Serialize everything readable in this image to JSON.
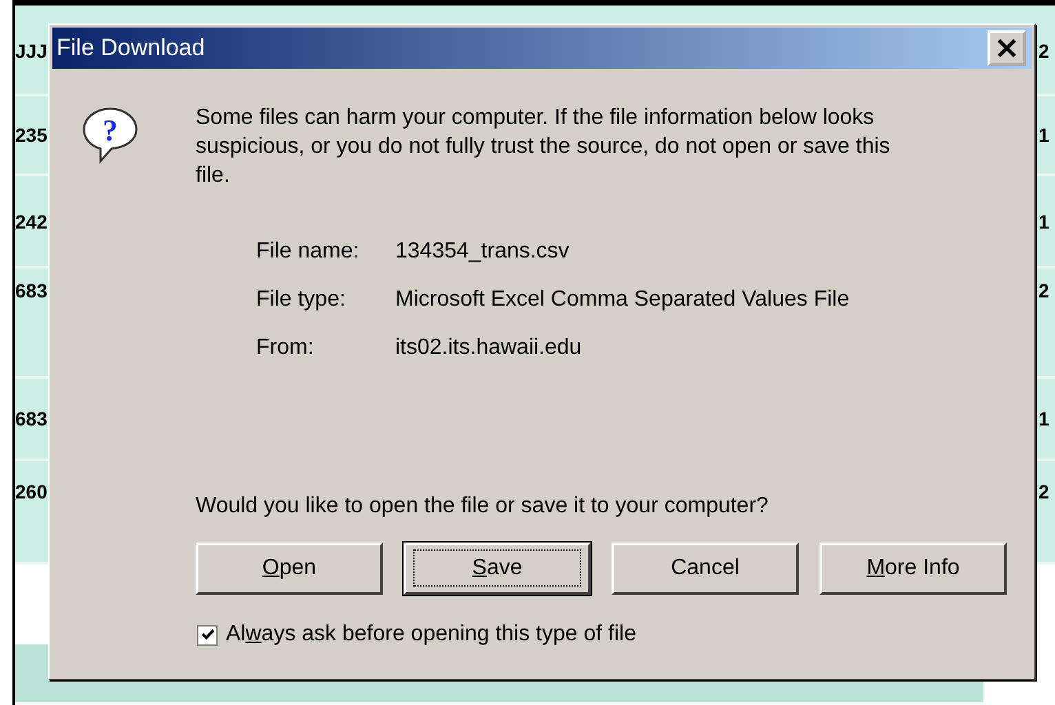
{
  "background_table": {
    "left_column": [
      "JJJ",
      "235",
      "242",
      "683",
      "683",
      "260"
    ],
    "right_column": [
      "2",
      "1",
      "1",
      "2",
      "1",
      "2"
    ]
  },
  "dialog": {
    "title": "File Download",
    "icon_glyph": "?",
    "message": "Some files can harm your computer. If the file information below looks suspicious, or you do not fully trust the source, do not open or save this file.",
    "details": [
      {
        "label": "File name:",
        "value": "134354_trans.csv"
      },
      {
        "label": "File type:",
        "value": "Microsoft Excel Comma Separated Values File"
      },
      {
        "label": "From:",
        "value": "its02.its.hawaii.edu"
      }
    ],
    "question": "Would you like to open the file or save it to your computer?",
    "buttons": [
      {
        "key": "O",
        "after": "pen",
        "focused": false
      },
      {
        "key": "S",
        "after": "ave",
        "focused": true
      },
      {
        "before": "Cancel",
        "focused": false
      },
      {
        "key": "M",
        "after": "ore Info",
        "focused": false
      }
    ],
    "checkbox": {
      "before": "Al",
      "key": "w",
      "after": "ays ask before opening this type of file",
      "checked": true
    }
  }
}
